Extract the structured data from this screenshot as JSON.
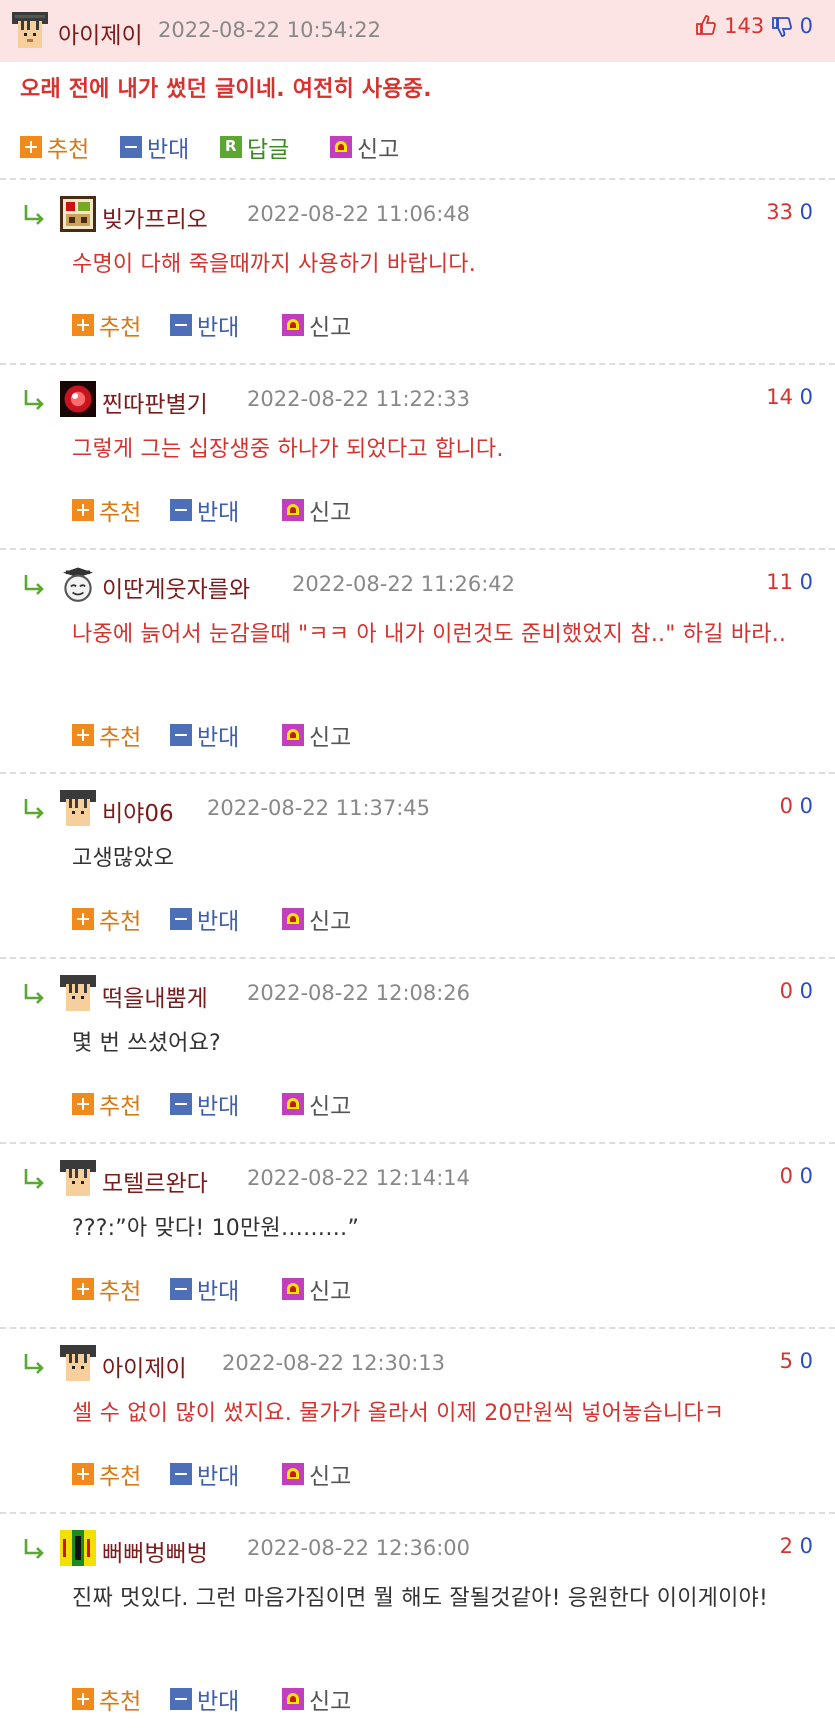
{
  "actions": {
    "recommend": "추천",
    "oppose": "반대",
    "reply": "답글",
    "report": "신고"
  },
  "colors": {
    "header_bg": "#fde4e4",
    "red_text": "#d6322e",
    "username": "#7a1c1c",
    "timestamp": "#888888",
    "upvote": "#d6322e",
    "downvote": "#2c4cc4"
  },
  "top": {
    "user": "아이제이",
    "time": "2022-08-22 10:54:22",
    "up": "143",
    "down": "0",
    "text": "오래 전에 내가 썼던 글이네. 여전히 사용중."
  },
  "replies": [
    {
      "user": "빚가프리오",
      "time": "2022-08-22 11:06:48",
      "up": "33",
      "down": "0",
      "text": "수명이 다해 죽을때까지 사용하기 바랍니다.",
      "red": true
    },
    {
      "user": "찐따판별기",
      "time": "2022-08-22 11:22:33",
      "up": "14",
      "down": "0",
      "text": "그렇게 그는 십장생중 하나가 되었다고 합니다.",
      "red": true
    },
    {
      "user": "이딴게웃자를와",
      "time": "2022-08-22 11:26:42",
      "up": "11",
      "down": "0",
      "text": "나중에 늙어서 눈감을때 \"ㅋㅋ 아 내가 이런것도 준비했었지 참..\" 하길 바라..",
      "red": true
    },
    {
      "user": "비야06",
      "time": "2022-08-22 11:37:45",
      "up": "0",
      "down": "0",
      "text": "고생많았오",
      "red": false
    },
    {
      "user": "떡을내뿜게",
      "time": "2022-08-22 12:08:26",
      "up": "0",
      "down": "0",
      "text": "몇 번 쓰셨어요?",
      "red": false
    },
    {
      "user": "모텔르완다",
      "time": "2022-08-22 12:14:14",
      "up": "0",
      "down": "0",
      "text": "???:”아 맞다! 10만원………”",
      "red": false
    },
    {
      "user": "아이제이",
      "time": "2022-08-22 12:30:13",
      "up": "5",
      "down": "0",
      "text": "셀 수 없이 많이 썼지요. 물가가 올라서 이제 20만원씩 넣어놓습니다ㅋ",
      "red": true
    },
    {
      "user": "뻐뻐벙뻐벙",
      "time": "2022-08-22 12:36:00",
      "up": "2",
      "down": "0",
      "text": "진짜 멋있다. 그런 마음가짐이면 뭘 해도 잘될것같아! 응원한다 이이게이야!",
      "red": false
    }
  ]
}
